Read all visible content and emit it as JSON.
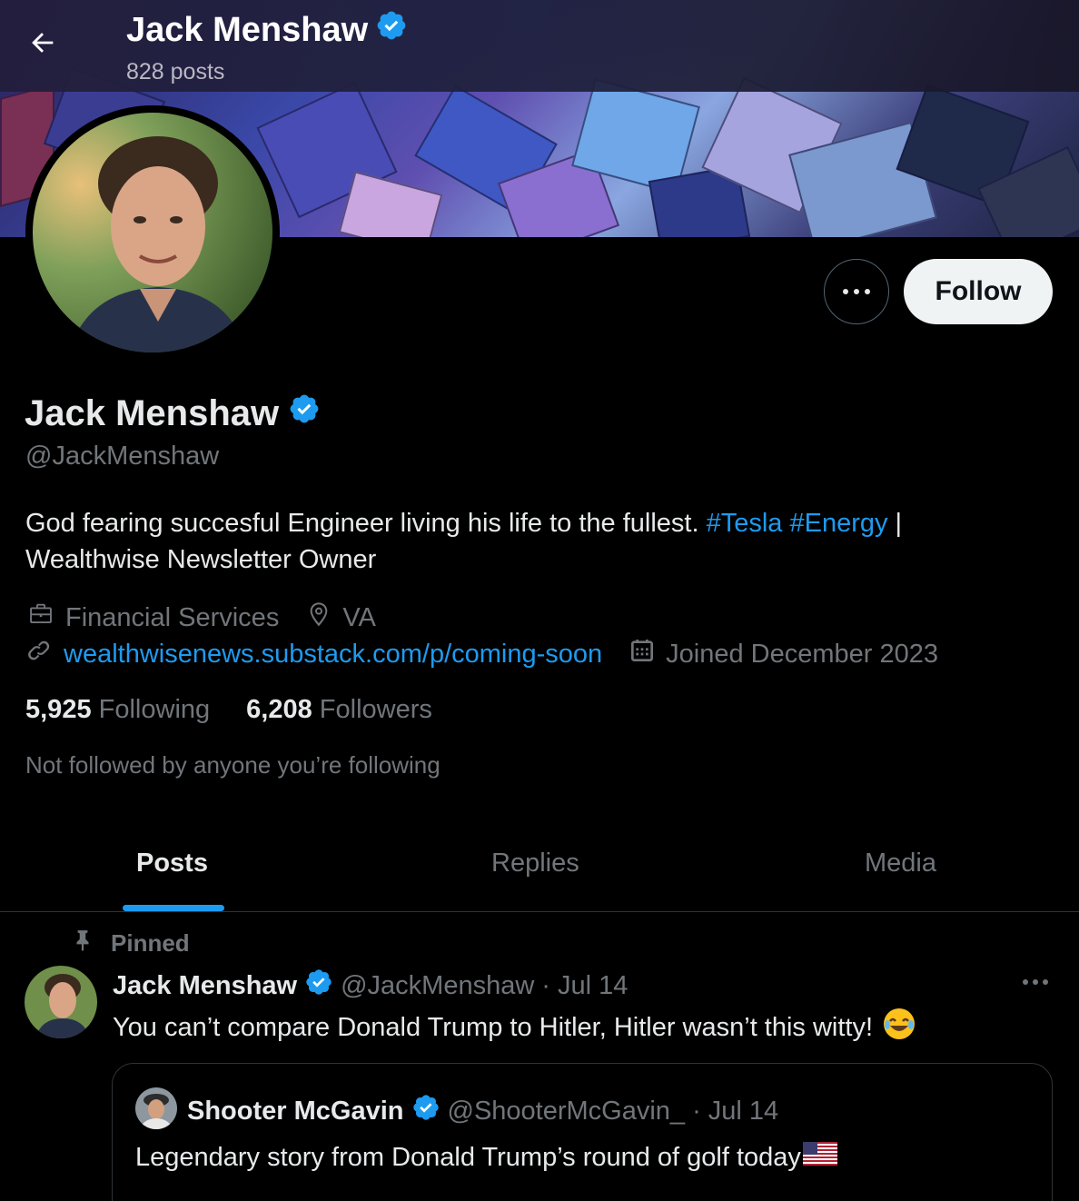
{
  "header": {
    "name": "Jack Menshaw",
    "posts_count": "828 posts"
  },
  "profile": {
    "name": "Jack Menshaw",
    "handle": "@JackMenshaw",
    "bio_text": "God fearing succesful Engineer living his life to the fullest. ",
    "bio_tag1": "#Tesla",
    "bio_tag2": "#Energy",
    "bio_suffix": " | Wealthwise Newsletter Owner",
    "category": "Financial Services",
    "location": "VA",
    "website": "wealthwisenews.substack.com/p/coming-soon",
    "joined": "Joined December 2023",
    "following_count": "5,925",
    "following_label": "Following",
    "followers_count": "6,208",
    "followers_label": "Followers",
    "not_followed": "Not followed by anyone you’re following"
  },
  "actions": {
    "follow_label": "Follow"
  },
  "tabs": [
    {
      "label": "Posts",
      "active": true
    },
    {
      "label": "Replies",
      "active": false
    },
    {
      "label": "Media",
      "active": false
    }
  ],
  "pinned_post": {
    "pinned_label": "Pinned",
    "author": "Jack Menshaw",
    "handle": "@JackMenshaw",
    "date": "· Jul 14",
    "text": "You can’t compare Donald Trump to Hitler, Hitler wasn’t this witty!",
    "emoji": "😂",
    "quote": {
      "author": "Shooter McGavin",
      "handle": "@ShooterMcGavin_",
      "date": "· Jul 14",
      "text": "Legendary story from Donald Trump’s round of golf today"
    }
  },
  "colors": {
    "accent": "#1d9bf0",
    "verified": "#1d9bf0",
    "muted": "#71767b"
  },
  "icons": [
    "back-arrow-icon",
    "verified-badge-icon",
    "more-icon",
    "briefcase-icon",
    "location-pin-icon",
    "link-icon",
    "calendar-icon",
    "pin-icon",
    "laughing-emoji-icon",
    "us-flag-icon"
  ]
}
